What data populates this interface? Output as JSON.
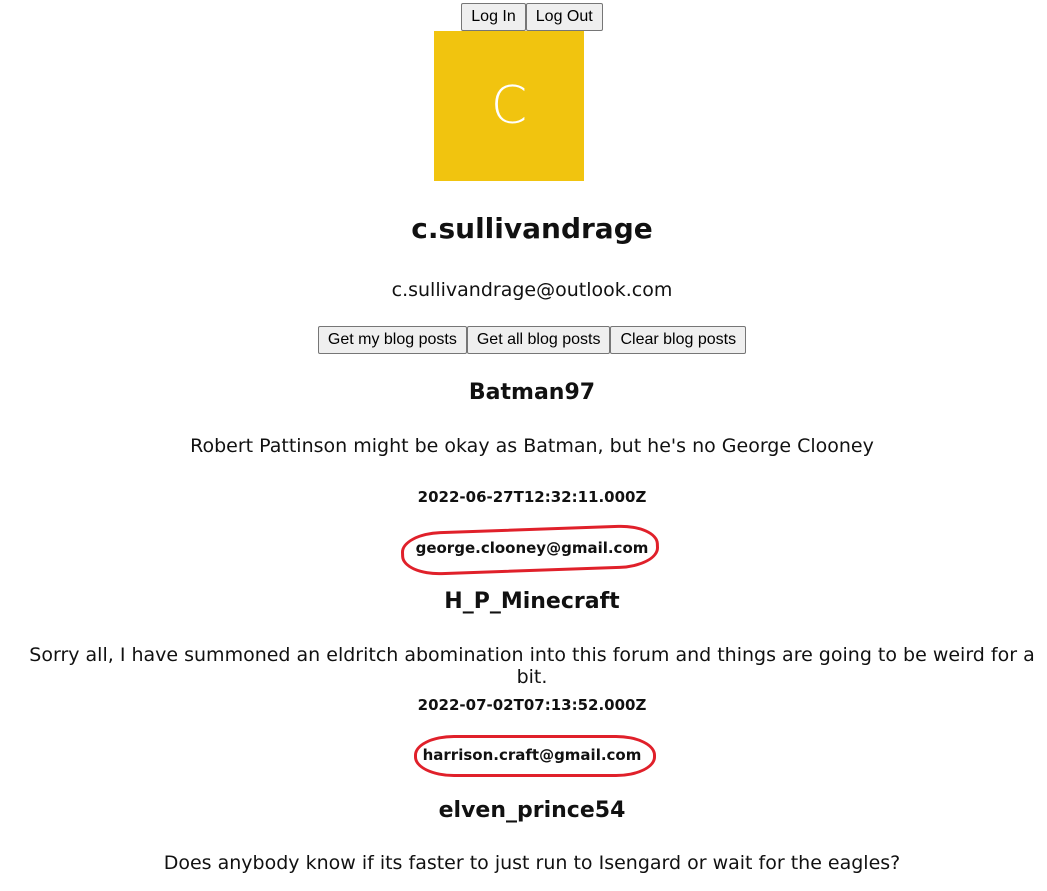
{
  "auth": {
    "login_label": "Log In",
    "logout_label": "Log Out"
  },
  "profile": {
    "avatar_letter": "C",
    "avatar_color": "#f1c40f",
    "name": "c.sullivandrage",
    "email": "c.sullivandrage@outlook.com"
  },
  "blog_controls": {
    "get_mine_label": "Get my blog posts",
    "get_all_label": "Get all blog posts",
    "clear_label": "Clear blog posts"
  },
  "posts": [
    {
      "author": "Batman97",
      "body": "Robert Pattinson might be okay as Batman, but he's no George Clooney",
      "date": "2022-06-27T12:32:11.000Z",
      "email": "george.clooney@gmail.com"
    },
    {
      "author": "H_P_Minecraft",
      "body": "Sorry all, I have summoned an eldritch abomination into this forum and things are going to be weird for a bit.",
      "date": "2022-07-02T07:13:52.000Z",
      "email": "harrison.craft@gmail.com"
    },
    {
      "author": "elven_prince54",
      "body": "Does anybody know if its faster to just run to Isengard or wait for the eagles?"
    }
  ],
  "annotation_color": "#e0202a"
}
